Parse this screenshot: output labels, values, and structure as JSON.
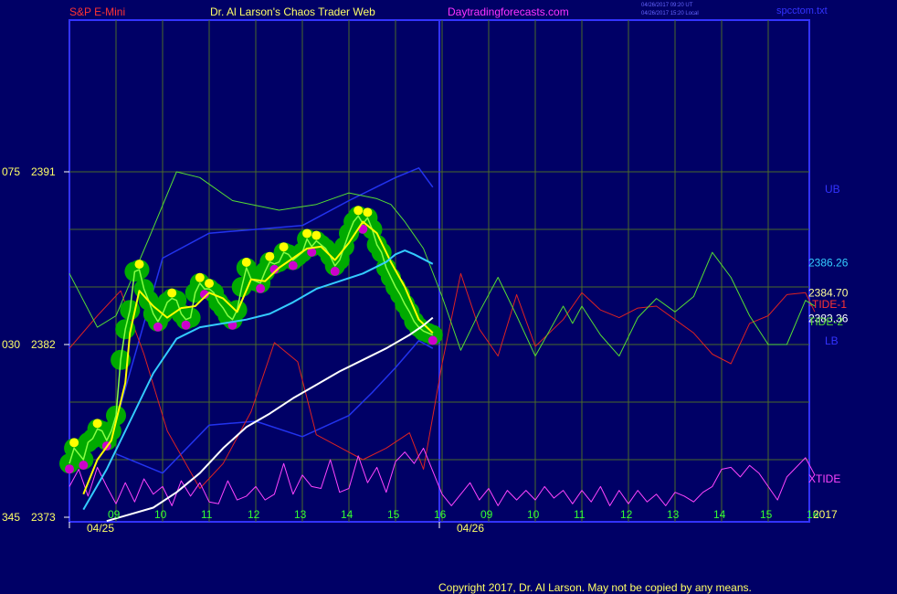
{
  "header": {
    "instrument": "S&P E-Mini",
    "site_title": "Dr. Al Larson's Chaos Trader Web",
    "site_url": "Daytradingforecasts.com",
    "timestamp_ut": "04/26/2017 09:20 UT",
    "timestamp_local": "04/26/2017 15:20 Local",
    "file_name": "spcctom.txt"
  },
  "footer": {
    "copyright": "Copyright 2017, Dr. Al Larson. May not be copied by any means."
  },
  "colors": {
    "background": "#000066",
    "frame": "#3333ff",
    "grid": "#4a6a2a",
    "title_red": "#ff3333",
    "title_yellow": "#ffff66",
    "title_magenta": "#ff33ff",
    "price_green": "#00aa00",
    "price_yellow": "#ffff00",
    "price_magenta": "#cc00cc",
    "ema_fast": "#ffff00",
    "ema_cyan": "#33ccff",
    "ema_white": "#ffffff",
    "tide1": "#dd2222",
    "tide2": "#55dd33",
    "xtide": "#ff44ff",
    "band": "#2233ee"
  },
  "chart_data": {
    "type": "line",
    "x_axis": {
      "day1_label": "04/25",
      "day2_label": "04/26",
      "day1_hours": [
        "09",
        "10",
        "11",
        "12",
        "13",
        "14",
        "15",
        "16"
      ],
      "day2_hours": [
        "09",
        "10",
        "11",
        "12",
        "13",
        "14",
        "15",
        "16"
      ],
      "trailing_label": "2017"
    },
    "y_axis": {
      "tick_labels": [
        {
          "left": "075",
          "price": "2391",
          "value": 2391
        },
        {
          "left": "030",
          "price": "2382",
          "value": 2382
        },
        {
          "left": "345",
          "price": "2373",
          "value": 2373
        }
      ],
      "range": [
        2373,
        2391
      ]
    },
    "right_labels": [
      {
        "text": "UB",
        "value": 2390.1,
        "color": "#3333ff"
      },
      {
        "text": "2386.26",
        "value": 2386.26,
        "color": "#33ccff"
      },
      {
        "text": "2384.70",
        "value": 2384.7,
        "color": "#ffff99"
      },
      {
        "text": "-TIDE-1",
        "value": 2384.1,
        "color": "#ff3333"
      },
      {
        "text": "2383.36",
        "value": 2383.36,
        "color": "#ffffff"
      },
      {
        "text": "TIDE-2",
        "value": 2383.2,
        "color": "#55dd33"
      },
      {
        "text": "LB",
        "value": 2382.2,
        "color": "#3333ff"
      },
      {
        "text": "XTIDE",
        "value": 2375.0,
        "color": "#ff44ff"
      }
    ],
    "series": [
      {
        "name": "price",
        "x": [
          0.0,
          0.1,
          0.2,
          0.3,
          0.4,
          0.5,
          0.6,
          0.7,
          0.8,
          0.9,
          1.0,
          1.1,
          1.2,
          1.3,
          1.4,
          1.5,
          1.6,
          1.7,
          1.8,
          1.9,
          2.0,
          2.1,
          2.2,
          2.3,
          2.4,
          2.5,
          2.6,
          2.7,
          2.8,
          2.9,
          3.0,
          3.1,
          3.2,
          3.3,
          3.4,
          3.5,
          3.6,
          3.7,
          3.8,
          3.9,
          4.0,
          4.1,
          4.2,
          4.3,
          4.4,
          4.5,
          4.6,
          4.7,
          4.8,
          4.9,
          5.0,
          5.1,
          5.2,
          5.3,
          5.4,
          5.5,
          5.6,
          5.7,
          5.8,
          5.9,
          6.0,
          6.1,
          6.2,
          6.3,
          6.4,
          6.5,
          6.6,
          6.7,
          6.8,
          6.9,
          7.0,
          7.1,
          7.2,
          7.3,
          7.4,
          7.5,
          7.6,
          7.7,
          7.8
        ],
        "y": [
          2375.8,
          2376.6,
          2376.3,
          2376.0,
          2376.9,
          2377.1,
          2377.6,
          2377.5,
          2377.0,
          2377.5,
          2378.3,
          2381.2,
          2382.8,
          2383.8,
          2385.8,
          2385.9,
          2384.9,
          2384.3,
          2383.6,
          2383.2,
          2383.6,
          2384.2,
          2384.4,
          2384.3,
          2383.6,
          2383.3,
          2383.4,
          2384.7,
          2385.2,
          2384.9,
          2384.9,
          2384.7,
          2384.2,
          2383.9,
          2383.5,
          2383.3,
          2383.8,
          2385.0,
          2386.0,
          2385.4,
          2385.3,
          2385.2,
          2385.8,
          2386.3,
          2386.2,
          2386.3,
          2386.8,
          2386.7,
          2386.4,
          2386.6,
          2386.8,
          2387.5,
          2387.1,
          2387.4,
          2387.2,
          2387.0,
          2386.6,
          2386.1,
          2386.4,
          2387.1,
          2387.8,
          2388.4,
          2388.7,
          2388.3,
          2388.6,
          2388.0,
          2387.2,
          2386.8,
          2386.0,
          2385.5,
          2385.0,
          2384.6,
          2384.1,
          2383.7,
          2383.2,
          2382.9,
          2382.7,
          2382.6,
          2382.5
        ]
      },
      {
        "name": "fast-average",
        "x": [
          0.3,
          0.6,
          0.9,
          1.2,
          1.3,
          1.5,
          1.8,
          2.1,
          2.4,
          2.7,
          3.0,
          3.3,
          3.6,
          3.9,
          4.2,
          4.5,
          4.8,
          5.1,
          5.4,
          5.7,
          6.0,
          6.3,
          6.6,
          6.9,
          7.2,
          7.5,
          7.8
        ],
        "y": [
          2374.2,
          2376.0,
          2377.0,
          2380.0,
          2382.6,
          2384.8,
          2384.0,
          2383.4,
          2383.9,
          2384.0,
          2384.7,
          2384.4,
          2383.7,
          2385.4,
          2385.3,
          2386.0,
          2386.5,
          2387.0,
          2387.1,
          2386.4,
          2387.3,
          2388.4,
          2387.8,
          2386.3,
          2385.0,
          2383.3,
          2382.6
        ]
      },
      {
        "name": "cyan-average",
        "x": [
          0.3,
          0.8,
          1.3,
          1.8,
          2.3,
          2.8,
          3.3,
          3.8,
          4.3,
          4.8,
          5.3,
          5.8,
          6.3,
          6.8,
          7.0,
          7.2,
          7.4,
          7.8
        ],
        "y": [
          2373.4,
          2375.5,
          2378.0,
          2380.5,
          2382.3,
          2382.9,
          2383.1,
          2383.3,
          2383.6,
          2384.2,
          2384.9,
          2385.3,
          2385.7,
          2386.3,
          2386.7,
          2386.9,
          2386.7,
          2386.2
        ]
      },
      {
        "name": "white-average",
        "x": [
          0.8,
          1.8,
          2.3,
          2.8,
          3.3,
          3.8,
          4.3,
          4.8,
          5.3,
          5.8,
          6.3,
          6.8,
          7.3,
          7.6,
          7.8
        ],
        "y": [
          2372.8,
          2373.5,
          2374.3,
          2375.3,
          2376.6,
          2377.7,
          2378.4,
          2379.2,
          2379.9,
          2380.6,
          2381.2,
          2381.8,
          2382.5,
          2383.0,
          2383.4
        ]
      },
      {
        "name": "TIDE-2",
        "x": [
          0.0,
          0.6,
          1.0,
          1.7,
          2.3,
          2.8,
          3.5,
          4.5,
          5.3,
          6.0,
          6.6,
          6.9,
          7.2,
          7.6,
          8.0,
          8.4,
          8.8,
          9.2,
          9.6,
          10.0,
          10.6,
          10.8,
          11.0,
          11.4,
          11.8,
          12.2,
          12.6,
          13.0,
          13.4,
          13.8,
          14.2,
          14.6,
          15.0,
          15.4,
          15.8,
          16.0
        ],
        "y": [
          2385.7,
          2382.9,
          2383.5,
          2387.5,
          2391.0,
          2390.7,
          2389.5,
          2389.0,
          2389.3,
          2389.9,
          2389.6,
          2389.3,
          2388.4,
          2387.0,
          2384.5,
          2381.7,
          2383.7,
          2385.5,
          2383.5,
          2381.4,
          2384.0,
          2383.1,
          2384.0,
          2382.5,
          2381.4,
          2383.4,
          2384.4,
          2383.7,
          2384.5,
          2386.8,
          2385.5,
          2383.5,
          2382.0,
          2382.0,
          2384.3,
          2384.0
        ]
      },
      {
        "name": "TIDE-1",
        "x": [
          0.0,
          0.6,
          1.1,
          1.6,
          2.1,
          2.8,
          3.3,
          3.9,
          4.4,
          4.9,
          5.3,
          6.3,
          6.8,
          7.3,
          7.6,
          8.0,
          8.4,
          8.8,
          9.2,
          9.6,
          10.0,
          10.6,
          11.0,
          11.4,
          11.8,
          12.2,
          12.6,
          13.0,
          13.4,
          13.8,
          14.2,
          14.6,
          15.0,
          15.4,
          15.8,
          16.0
        ],
        "y": [
          2381.8,
          2383.5,
          2384.8,
          2381.5,
          2377.5,
          2374.5,
          2375.8,
          2378.5,
          2382.1,
          2381.1,
          2377.3,
          2376.0,
          2376.6,
          2377.4,
          2375.5,
          2381.0,
          2385.7,
          2382.8,
          2381.4,
          2384.6,
          2381.9,
          2383.3,
          2384.7,
          2383.8,
          2383.4,
          2383.9,
          2384.0,
          2383.3,
          2382.6,
          2381.5,
          2381.0,
          2383.1,
          2383.5,
          2384.6,
          2384.7,
          2383.7
        ]
      },
      {
        "name": "upper-band",
        "x": [
          1.0,
          2.0,
          3.0,
          4.0,
          5.0,
          6.0,
          6.5,
          7.0,
          7.5,
          7.8
        ],
        "y": [
          2378.0,
          2386.5,
          2387.8,
          2388.0,
          2388.2,
          2389.5,
          2390.1,
          2390.7,
          2391.2,
          2390.2
        ]
      },
      {
        "name": "lower-band",
        "x": [
          1.0,
          2.0,
          3.0,
          4.0,
          5.0,
          6.0,
          6.5,
          7.0,
          7.5,
          7.8
        ],
        "y": [
          2376.3,
          2375.3,
          2377.8,
          2378.0,
          2377.2,
          2378.3,
          2379.5,
          2380.8,
          2382.2,
          2381.8
        ]
      },
      {
        "name": "XTIDE",
        "x": [
          0.0,
          0.2,
          0.4,
          0.6,
          0.8,
          1.0,
          1.2,
          1.4,
          1.6,
          1.8,
          2.0,
          2.2,
          2.4,
          2.6,
          2.8,
          3.0,
          3.2,
          3.4,
          3.6,
          3.8,
          4.0,
          4.2,
          4.4,
          4.6,
          4.8,
          5.0,
          5.2,
          5.4,
          5.6,
          5.8,
          6.0,
          6.2,
          6.4,
          6.6,
          6.8,
          7.0,
          7.2,
          7.4,
          7.6,
          7.8,
          8.0,
          8.2,
          8.4,
          8.6,
          8.8,
          9.0,
          9.2,
          9.4,
          9.6,
          9.8,
          10.0,
          10.2,
          10.4,
          10.6,
          10.8,
          11.0,
          11.2,
          11.4,
          11.6,
          11.8,
          12.0,
          12.2,
          12.4,
          12.6,
          12.8,
          13.0,
          13.2,
          13.4,
          13.6,
          13.8,
          14.0,
          14.2,
          14.4,
          14.6,
          14.8,
          15.0,
          15.2,
          15.4,
          15.6,
          15.8,
          16.0
        ],
        "y": [
          2374.6,
          2375.5,
          2374.1,
          2375.6,
          2374.6,
          2373.7,
          2374.8,
          2373.8,
          2375.0,
          2374.2,
          2374.6,
          2373.6,
          2374.9,
          2374.1,
          2374.8,
          2373.8,
          2373.7,
          2374.9,
          2373.9,
          2374.1,
          2374.6,
          2373.9,
          2374.2,
          2375.8,
          2374.2,
          2375.2,
          2374.6,
          2374.5,
          2376.0,
          2374.3,
          2374.5,
          2376.2,
          2374.8,
          2375.6,
          2374.3,
          2375.9,
          2376.4,
          2375.8,
          2376.6,
          2375.4,
          2374.2,
          2373.6,
          2374.2,
          2374.8,
          2373.9,
          2374.5,
          2373.6,
          2374.4,
          2373.9,
          2374.4,
          2373.9,
          2374.6,
          2374.0,
          2374.4,
          2373.7,
          2374.4,
          2373.8,
          2374.6,
          2373.6,
          2374.4,
          2373.7,
          2374.4,
          2373.8,
          2374.2,
          2373.6,
          2374.3,
          2374.1,
          2373.8,
          2374.3,
          2374.6,
          2375.5,
          2375.6,
          2375.1,
          2375.7,
          2375.3,
          2374.6,
          2373.9,
          2375.1,
          2375.6,
          2376.1,
          2375.2
        ]
      }
    ]
  }
}
